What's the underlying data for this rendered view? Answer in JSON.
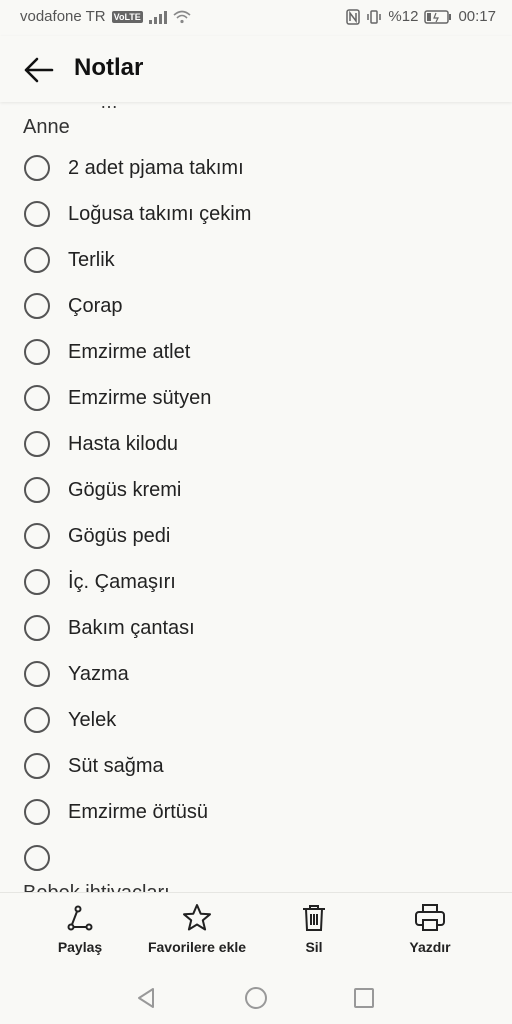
{
  "status_bar": {
    "carrier": "vodafone TR",
    "volte": "VoLTE",
    "battery": "%12",
    "time": "00:17"
  },
  "header": {
    "title": "Notlar"
  },
  "note": {
    "partial_top_text": "…",
    "section_title": "Anne",
    "items": [
      {
        "label": "2 adet pjama takımı",
        "checked": false
      },
      {
        "label": "Loğusa takımı çekim",
        "checked": false
      },
      {
        "label": "Terlik",
        "checked": false
      },
      {
        "label": "Çorap",
        "checked": false
      },
      {
        "label": "Emzirme atlet",
        "checked": false
      },
      {
        "label": "Emzirme sütyen",
        "checked": false
      },
      {
        "label": "Hasta kilodu",
        "checked": false
      },
      {
        "label": "Gögüs kremi",
        "checked": false
      },
      {
        "label": "Gögüs pedi",
        "checked": false
      },
      {
        "label": "İç. Çamaşırı",
        "checked": false
      },
      {
        "label": "Bakım çantası",
        "checked": false
      },
      {
        "label": "Yazma",
        "checked": false
      },
      {
        "label": "Yelek",
        "checked": false
      },
      {
        "label": "Süt sağma",
        "checked": false
      },
      {
        "label": "Emzirme örtüsü",
        "checked": false
      },
      {
        "label": "",
        "checked": false
      }
    ],
    "partial_bottom_text": "Bebek ihtiyaçları"
  },
  "toolbar": {
    "share_label": "Paylaş",
    "favorite_label": "Favorilere ekle",
    "delete_label": "Sil",
    "print_label": "Yazdır"
  }
}
